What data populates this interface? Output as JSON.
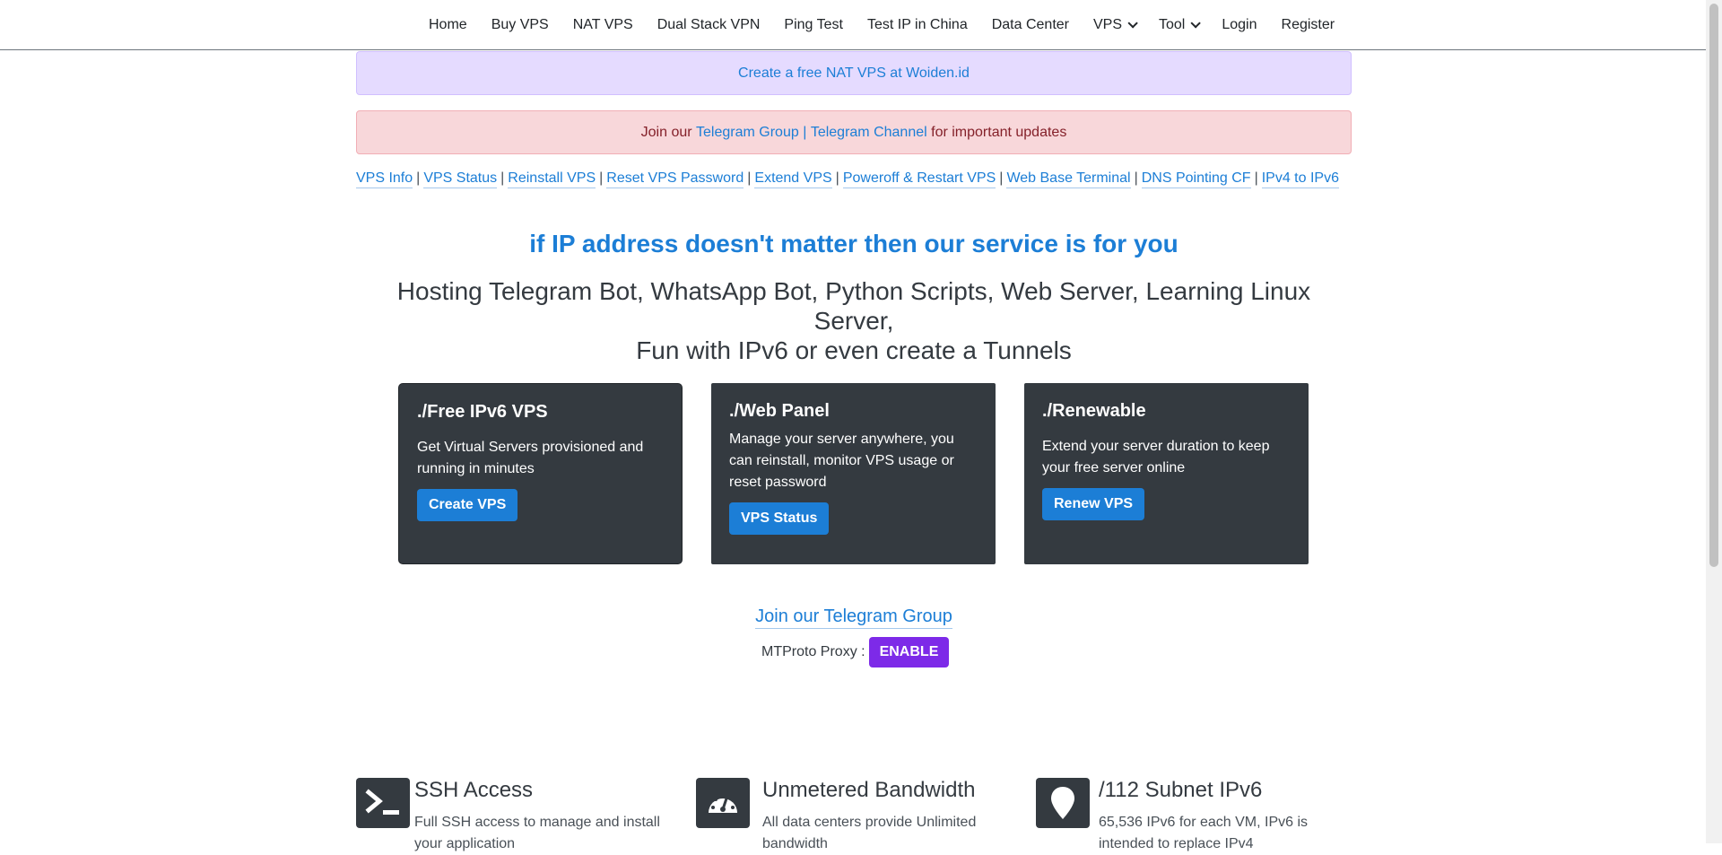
{
  "nav": {
    "items": [
      {
        "label": "Home"
      },
      {
        "label": "Buy VPS"
      },
      {
        "label": "NAT VPS"
      },
      {
        "label": "Dual Stack VPN"
      },
      {
        "label": "Ping Test"
      },
      {
        "label": "Test IP in China"
      },
      {
        "label": "Data Center"
      },
      {
        "label": "VPS"
      },
      {
        "label": "Tool"
      },
      {
        "label": "Login"
      },
      {
        "label": "Register"
      }
    ]
  },
  "alerts": {
    "nat": "Create a free NAT VPS at Woiden.id",
    "join_prefix": "Join our",
    "telegram_group": "Telegram Group",
    "divider": "|",
    "telegram_channel": "Telegram Channel",
    "join_suffix": "for important updates"
  },
  "quick_links": [
    "VPS Info",
    "VPS Status",
    "Reinstall VPS",
    "Reset VPS Password",
    "Extend VPS",
    "Poweroff & Restart VPS",
    "Web Base Terminal",
    "DNS Pointing CF",
    "IPv4 to IPv6"
  ],
  "quick_links_sep": "|",
  "hero": {
    "tagline": "if IP address doesn't matter then our service is for you",
    "sub_line1": "Hosting Telegram Bot, WhatsApp Bot, Python Scripts, Web Server, Learning Linux Server,",
    "sub_line2": "Fun with IPv6 or even create a Tunnels"
  },
  "cards": [
    {
      "title": "./Free IPv6 VPS",
      "text": "Get Virtual Servers provisioned and running in minutes",
      "button": "Create VPS"
    },
    {
      "title": "./Web Panel",
      "text": "Manage your server anywhere, you can reinstall, monitor VPS usage or reset password",
      "button": "VPS Status"
    },
    {
      "title": "./Renewable",
      "text": "Extend your server duration to keep your free server online",
      "button": "Renew VPS"
    }
  ],
  "telegram": {
    "join": "Join our Telegram Group",
    "proxy_label": "MTProto Proxy :",
    "enable": "ENABLE"
  },
  "features": [
    {
      "icon": "terminal-icon",
      "title": "SSH Access",
      "text": "Full SSH access to manage and install your application"
    },
    {
      "icon": "speedometer-icon",
      "title": "Unmetered Bandwidth",
      "text": "All data centers provide Unlimited bandwidth"
    },
    {
      "icon": "map-pin-icon",
      "title": "/112 Subnet IPv6",
      "text": "65,536 IPv6 for each VM, IPv6 is intended to replace IPv4"
    }
  ],
  "colors": {
    "link": "#1c7ed6",
    "card_bg": "#343a40",
    "purple_btn": "#7d2ae8",
    "alert_purple": "#e5dbff",
    "alert_red": "#f8d7da"
  }
}
